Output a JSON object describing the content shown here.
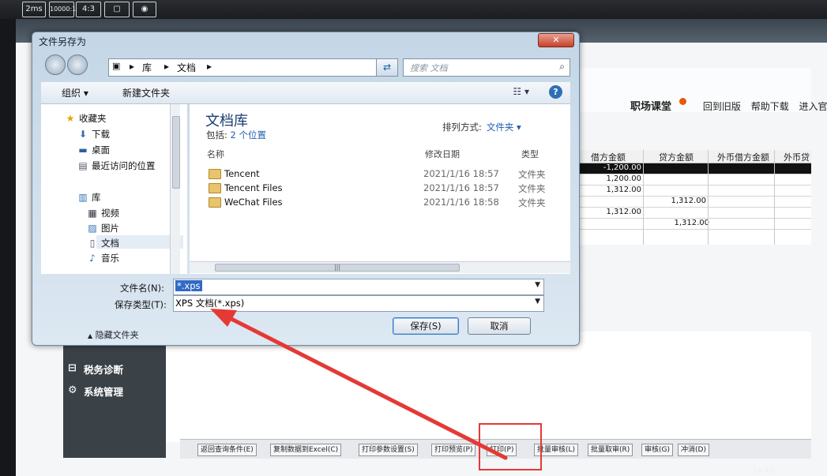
{
  "camera_strip": {
    "items": [
      "2ms",
      "10000:1",
      "4:3",
      "",
      ""
    ]
  },
  "background_app": {
    "brand": "职场课堂",
    "links": [
      "回到旧版",
      "帮助下载",
      "进入官网"
    ],
    "grid_headers": [
      "借方金额",
      "贷方金额",
      "外币借方金额",
      "外币贷方金"
    ],
    "grid_rows": [
      {
        "debit": "-1,200.00",
        "credit": "",
        "selected": true
      },
      {
        "debit": "1,200.00",
        "credit": ""
      },
      {
        "debit": "1,312.00",
        "credit": ""
      },
      {
        "debit": "",
        "credit": "1,312.00"
      },
      {
        "debit": "1,312.00",
        "credit": ""
      },
      {
        "debit": "",
        "credit": "1,312.00"
      }
    ],
    "sidebar": [
      {
        "label": "税务诊断",
        "icon": "briefcase-icon"
      },
      {
        "label": "系统管理",
        "icon": "gear-icon"
      }
    ],
    "bottom_buttons": [
      "返回查询条件(E)",
      "复制数据到Excel(C)",
      "打印参数设置(S)",
      "打印预览(P)",
      "打印(P)",
      "批量审核(L)",
      "批量取审(R)",
      "审核(G)",
      "冲消(D)"
    ],
    "clock": "14:42"
  },
  "dialog": {
    "title": "文件另存为",
    "close_label": "✕",
    "breadcrumb": [
      "库",
      "文档"
    ],
    "search_placeholder": "搜索 文档",
    "toolbar": {
      "organize": "组织 ▾",
      "new_folder": "新建文件夹"
    },
    "nav": {
      "favorites_label": "收藏夹",
      "favorites": [
        "下载",
        "桌面",
        "最近访问的位置"
      ],
      "libraries_label": "库",
      "libraries": [
        "视频",
        "图片",
        "文档",
        "音乐"
      ]
    },
    "library": {
      "title": "文档库",
      "includes_label": "包括:",
      "includes_link": "2 个位置",
      "arrange_label": "排列方式:",
      "arrange_value": "文件夹 ▾"
    },
    "columns": {
      "name": "名称",
      "date": "修改日期",
      "type": "类型"
    },
    "files": [
      {
        "name": "Tencent",
        "date": "2021/1/16 18:57",
        "type": "文件夹"
      },
      {
        "name": "Tencent Files",
        "date": "2021/1/16 18:57",
        "type": "文件夹"
      },
      {
        "name": "WeChat Files",
        "date": "2021/1/16 18:58",
        "type": "文件夹"
      }
    ],
    "filename_label": "文件名(N):",
    "filename_value": "*.xps",
    "filetype_label": "保存类型(T):",
    "filetype_value": "XPS 文档(*.xps)",
    "hide_folders": "隐藏文件夹",
    "save_label": "保存(S)",
    "cancel_label": "取消"
  },
  "colors": {
    "annotation_red": "#e53935",
    "link_blue": "#1f5fb0",
    "title_blue": "#1a3c73"
  }
}
